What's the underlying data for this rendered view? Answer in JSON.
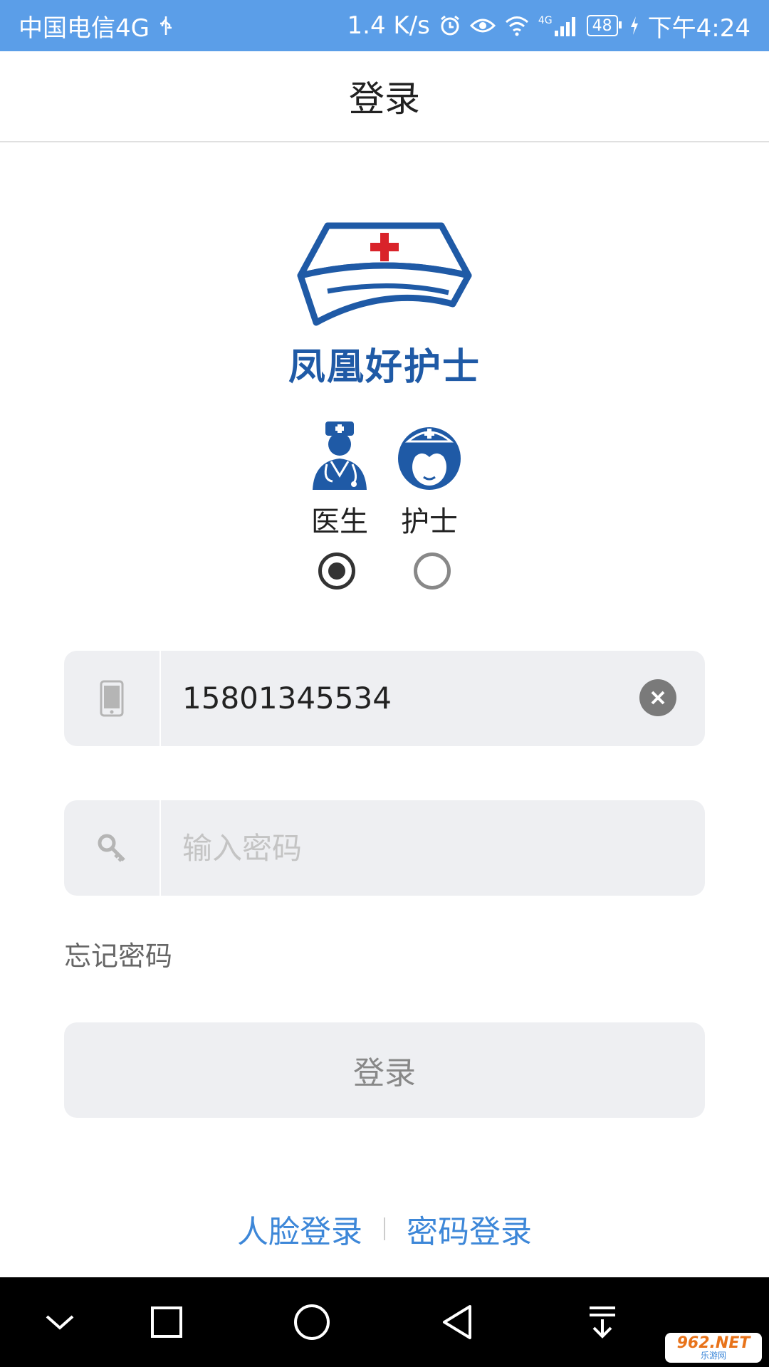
{
  "status_bar": {
    "carrier": "中国电信4G",
    "network_speed": "1.4 K/s",
    "signal_type": "4G",
    "battery": "48",
    "time": "下午4:24"
  },
  "header": {
    "title": "登录"
  },
  "logo": {
    "brand_name": "凤凰好护士"
  },
  "roles": [
    {
      "label": "医生",
      "icon": "doctor-icon",
      "selected": true
    },
    {
      "label": "护士",
      "icon": "nurse-icon",
      "selected": false
    }
  ],
  "phone_field": {
    "value": "15801345534",
    "icon": "phone-icon",
    "clear_icon": "clear-icon"
  },
  "password_field": {
    "placeholder": "输入密码",
    "value": "",
    "icon": "key-icon"
  },
  "forgot_password": "忘记密码",
  "login_button": "登录",
  "alt_login": {
    "face": "人脸登录",
    "password": "密码登录"
  },
  "colors": {
    "accent": "#5b9ee8",
    "link": "#3d87d8",
    "brand": "#1f5aa6",
    "cross": "#d9232a"
  }
}
